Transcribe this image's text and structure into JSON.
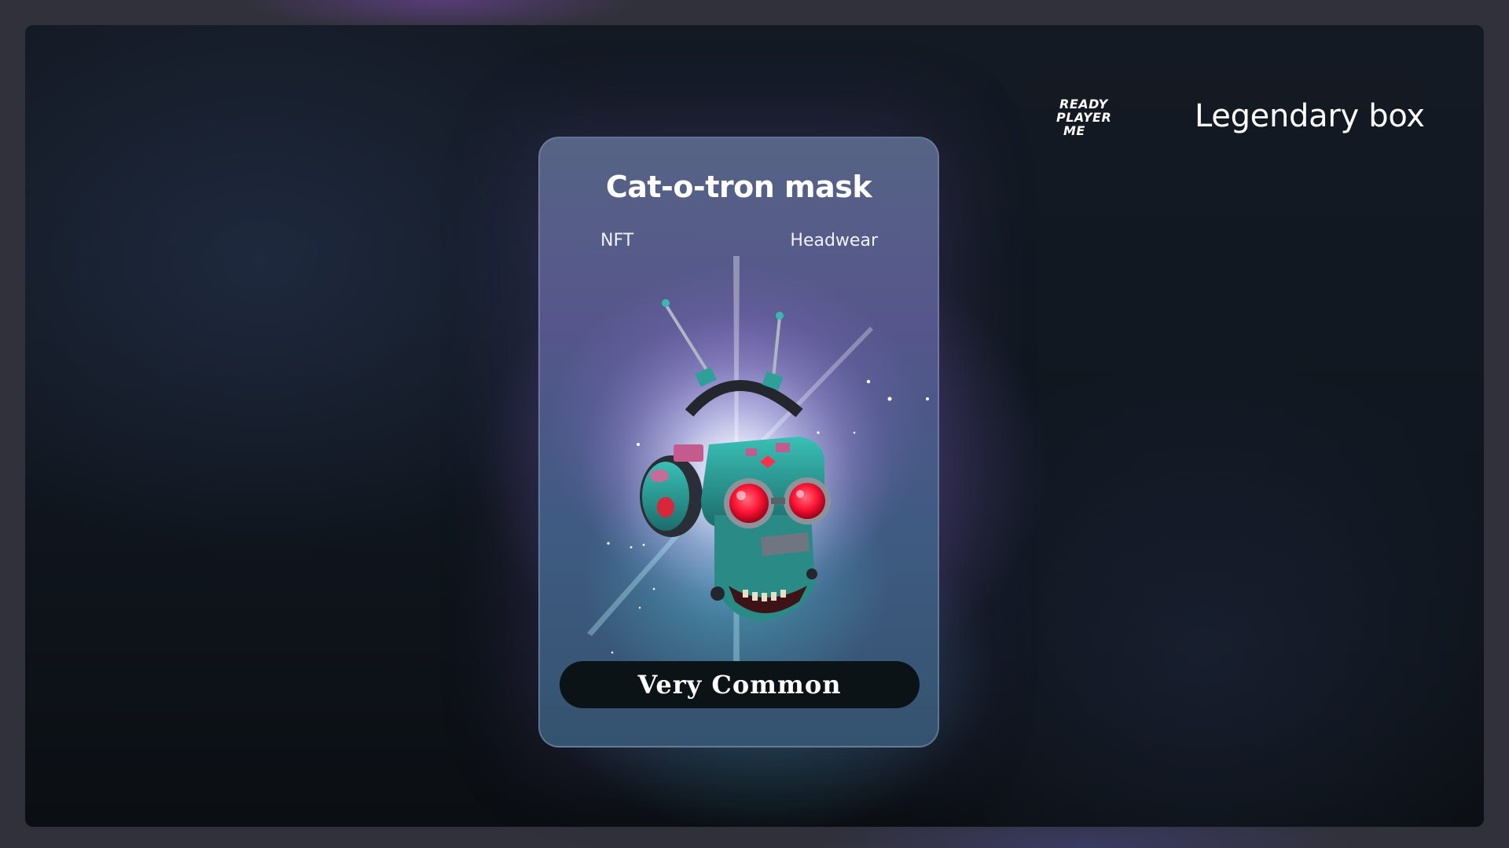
{
  "brand": {
    "logo_lines": [
      "READY",
      "PLAYER",
      "ME"
    ],
    "box_title": "Legendary box"
  },
  "card": {
    "title": "Cat-o-tron mask",
    "tag_left": "NFT",
    "tag_right": "Headwear",
    "rarity": "Very Common",
    "image_icon": "robot-cat-mask-illustration"
  },
  "colors": {
    "background": "#30313a",
    "frame": "#111720",
    "badge": "#0c1317",
    "mask_teal": "#2fa79e",
    "eye_red": "#ff1f3d"
  }
}
